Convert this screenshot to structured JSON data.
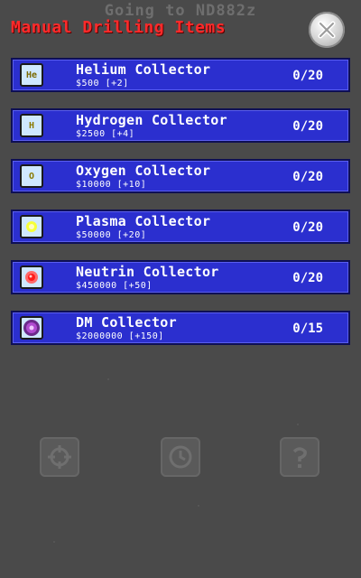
{
  "background": {
    "heading": "Going to ND882z"
  },
  "title": "Manual Drilling Items",
  "items": [
    {
      "name": "Helium Collector",
      "price": "$500 [+2]",
      "count": "0/20",
      "icon_label": "He",
      "icon": "helium-icon"
    },
    {
      "name": "Hydrogen Collector",
      "price": "$2500 [+4]",
      "count": "0/20",
      "icon_label": "H",
      "icon": "hydrogen-icon"
    },
    {
      "name": "Oxygen Collector",
      "price": "$10000 [+10]",
      "count": "0/20",
      "icon_label": "O",
      "icon": "oxygen-icon"
    },
    {
      "name": "Plasma Collector",
      "price": "$50000 [+20]",
      "count": "0/20",
      "icon_label": "",
      "icon": "plasma-icon"
    },
    {
      "name": "Neutrin Collector",
      "price": "$450000 [+50]",
      "count": "0/20",
      "icon_label": "",
      "icon": "neutrino-icon"
    },
    {
      "name": "DM Collector",
      "price": "$2000000 [+150]",
      "count": "0/15",
      "icon_label": "",
      "icon": "dark-matter-icon"
    }
  ],
  "colors": {
    "title": "#ff2a2a",
    "item_bg": "#2b2fcf",
    "item_border": "#0e0f55",
    "overlay": "#4a4a4a"
  }
}
